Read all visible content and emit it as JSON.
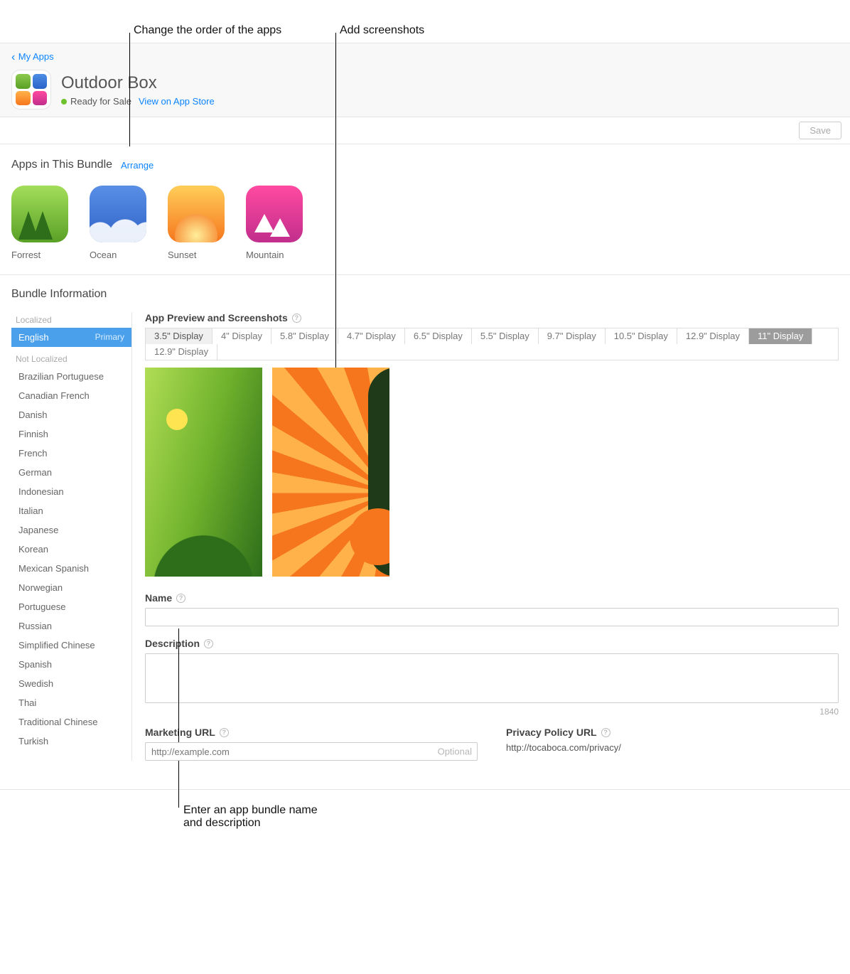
{
  "annotations": {
    "reorder": "Change the order of the apps",
    "add_screenshots": "Add screenshots",
    "enter_name_desc_l1": "Enter an app bundle name",
    "enter_name_desc_l2": "and description"
  },
  "header": {
    "back": "My Apps",
    "title": "Outdoor Box",
    "status": "Ready for Sale",
    "view_link": "View on App Store"
  },
  "toolbar": {
    "save": "Save"
  },
  "bundle_section": {
    "title": "Apps in This Bundle",
    "arrange": "Arrange",
    "apps": [
      {
        "name": "Forrest"
      },
      {
        "name": "Ocean"
      },
      {
        "name": "Sunset"
      },
      {
        "name": "Mountain"
      }
    ]
  },
  "info": {
    "title": "Bundle Information",
    "localized_heading": "Localized",
    "not_localized_heading": "Not Localized",
    "selected_lang": "English",
    "primary_tag": "Primary",
    "languages": [
      "Brazilian Portuguese",
      "Canadian French",
      "Danish",
      "Finnish",
      "French",
      "German",
      "Indonesian",
      "Italian",
      "Japanese",
      "Korean",
      "Mexican Spanish",
      "Norwegian",
      "Portuguese",
      "Russian",
      "Simplified Chinese",
      "Spanish",
      "Swedish",
      "Thai",
      "Traditional Chinese",
      "Turkish"
    ],
    "screenshots_label": "App Preview and Screenshots",
    "display_tabs": [
      "3.5\" Display",
      "4\" Display",
      "5.8\" Display",
      "4.7\" Display",
      "6.5\" Display",
      "5.5\" Display",
      "9.7\" Display",
      "10.5\" Display",
      "12.9\" Display",
      "11\" Display",
      "12.9\" Display"
    ],
    "name_label": "Name",
    "name_value": "",
    "desc_label": "Description",
    "desc_value": "",
    "desc_count": "1840",
    "marketing_label": "Marketing URL",
    "marketing_placeholder": "http://example.com",
    "marketing_optional": "Optional",
    "privacy_label": "Privacy Policy URL",
    "privacy_url": "http://tocaboca.com/privacy/"
  }
}
